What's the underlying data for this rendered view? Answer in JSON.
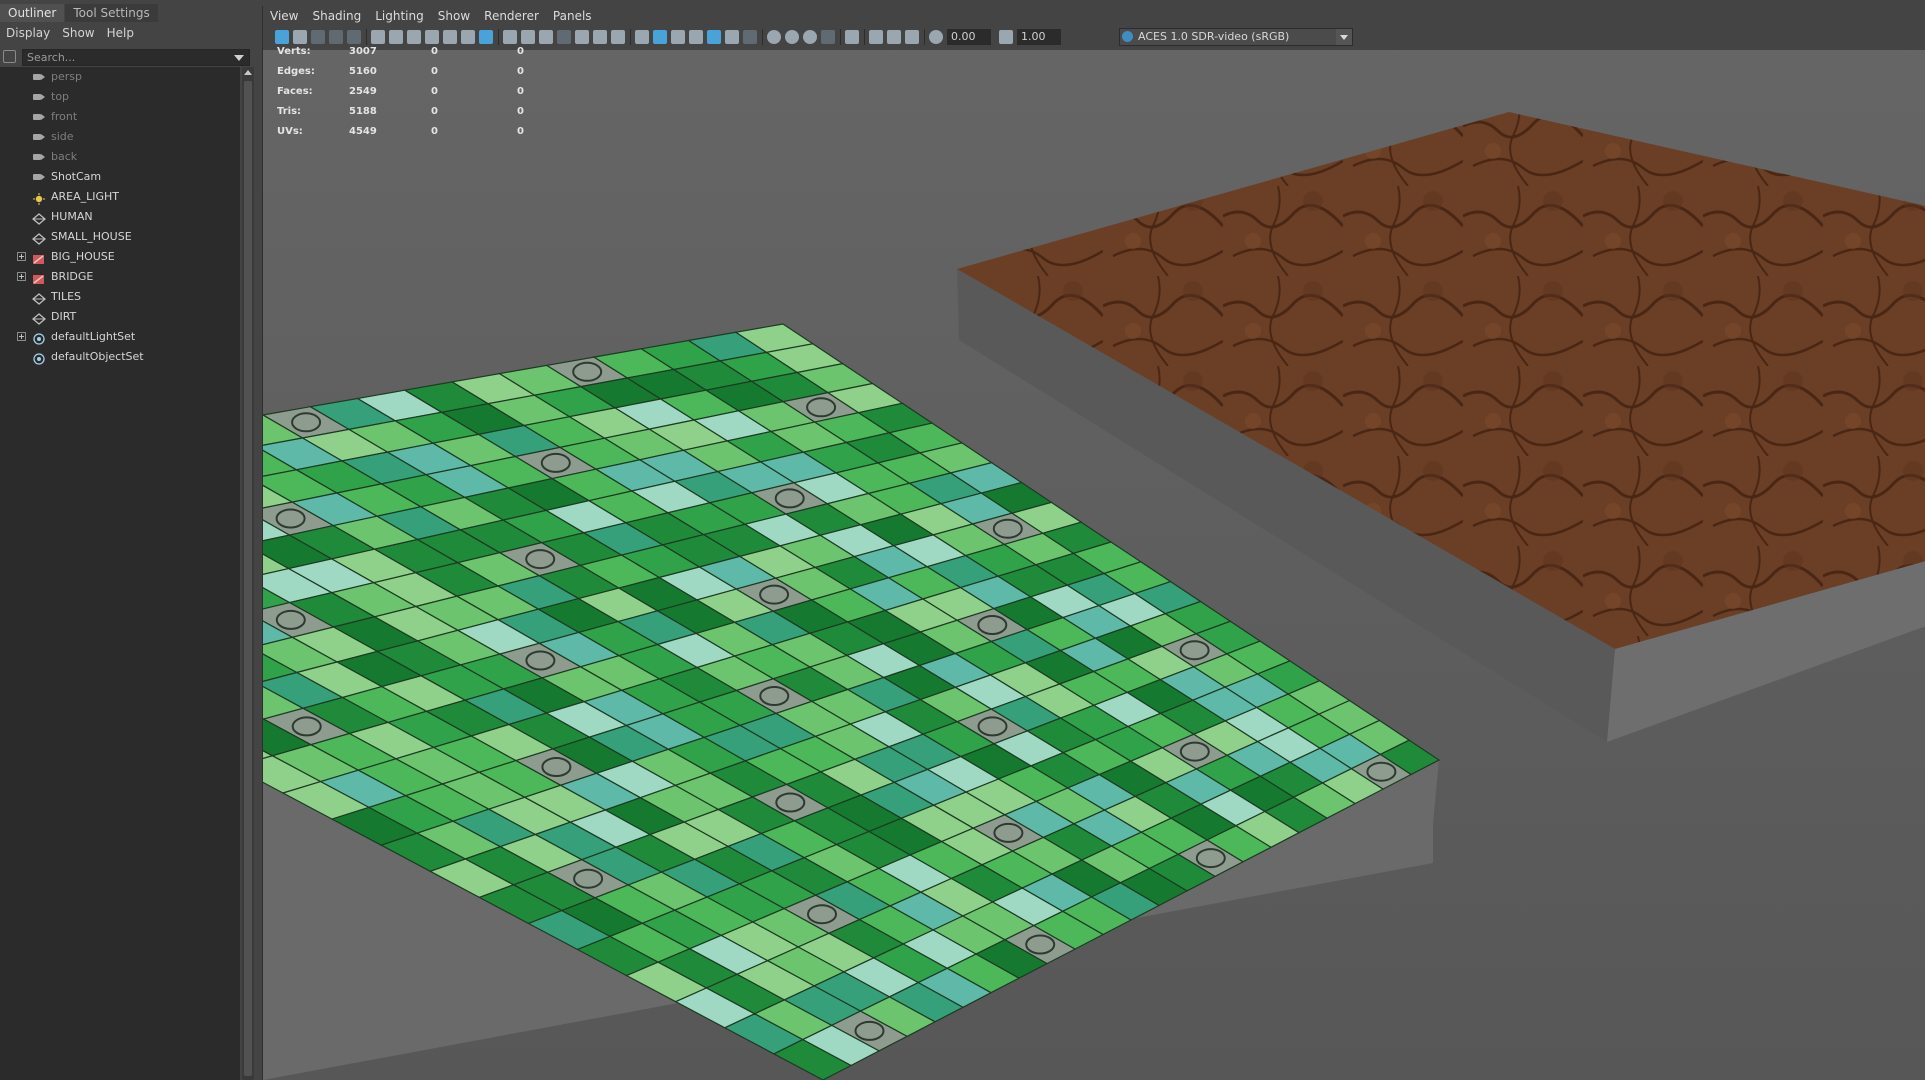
{
  "outliner": {
    "tabs": [
      "Outliner",
      "Tool Settings"
    ],
    "menu": [
      "Display",
      "Show",
      "Help"
    ],
    "search_placeholder": "Search...",
    "items": [
      {
        "label": "persp",
        "icon": "camera-icon",
        "dim": true,
        "expandable": false
      },
      {
        "label": "top",
        "icon": "camera-icon",
        "dim": true,
        "expandable": false
      },
      {
        "label": "front",
        "icon": "camera-icon",
        "dim": true,
        "expandable": false
      },
      {
        "label": "side",
        "icon": "camera-icon",
        "dim": true,
        "expandable": false
      },
      {
        "label": "back",
        "icon": "camera-icon",
        "dim": true,
        "expandable": false
      },
      {
        "label": "ShotCam",
        "icon": "camera-icon",
        "dim": false,
        "expandable": false
      },
      {
        "label": "AREA_LIGHT",
        "icon": "light-icon",
        "dim": false,
        "expandable": false
      },
      {
        "label": "HUMAN",
        "icon": "mesh-icon",
        "dim": false,
        "expandable": false
      },
      {
        "label": "SMALL_HOUSE",
        "icon": "mesh-icon",
        "dim": false,
        "expandable": false
      },
      {
        "label": "BIG_HOUSE",
        "icon": "group-icon",
        "dim": false,
        "expandable": true
      },
      {
        "label": "BRIDGE",
        "icon": "group-icon",
        "dim": false,
        "expandable": true
      },
      {
        "label": "TILES",
        "icon": "mesh-icon",
        "dim": false,
        "expandable": false
      },
      {
        "label": "DIRT",
        "icon": "mesh-icon",
        "dim": false,
        "expandable": false
      },
      {
        "label": "defaultLightSet",
        "icon": "set-icon",
        "dim": false,
        "expandable": true
      },
      {
        "label": "defaultObjectSet",
        "icon": "set-icon",
        "dim": false,
        "expandable": false
      }
    ]
  },
  "viewport": {
    "menu": [
      "View",
      "Shading",
      "Lighting",
      "Show",
      "Renderer",
      "Panels"
    ],
    "exposure": "0.00",
    "gamma": "1.00",
    "color_space": "ACES 1.0 SDR-video (sRGB)",
    "hud": [
      {
        "label": "Verts:",
        "v1": "3007",
        "v2": "0",
        "v3": "0"
      },
      {
        "label": "Edges:",
        "v1": "5160",
        "v2": "0",
        "v3": "0"
      },
      {
        "label": "Faces:",
        "v1": "2549",
        "v2": "0",
        "v3": "0"
      },
      {
        "label": "Tris:",
        "v1": "5188",
        "v2": "0",
        "v3": "0"
      },
      {
        "label": "UVs:",
        "v1": "4549",
        "v2": "0",
        "v3": "0"
      }
    ]
  },
  "colors": {
    "panel": "#444444",
    "tree_bg": "#2b2b2b",
    "viewport_bg": "#606060",
    "accent": "#4aa3d8",
    "tile_greens": [
      "#1f8a3a",
      "#2fa24a",
      "#4cb85a",
      "#6cc46e",
      "#8fd18a",
      "#36a07a",
      "#5fb9a8",
      "#9fd9c3",
      "#157a30"
    ],
    "dirt": "#6a3e24"
  }
}
